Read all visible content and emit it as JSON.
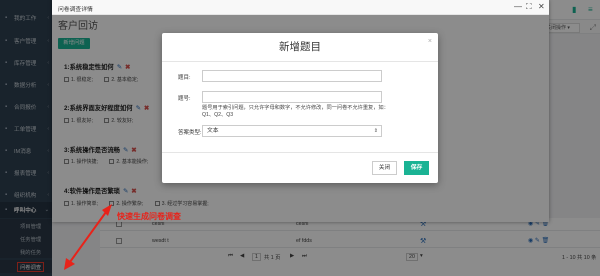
{
  "sidebar": {
    "items": [
      {
        "label": "我的工作",
        "icon": "briefcase-icon"
      },
      {
        "label": "客户管理",
        "icon": "user-icon"
      },
      {
        "label": "库存管理",
        "icon": "box-icon"
      },
      {
        "label": "数据分析",
        "icon": "chart-icon"
      },
      {
        "label": "合同报价",
        "icon": "file-icon"
      },
      {
        "label": "工单管理",
        "icon": "ticket-icon"
      },
      {
        "label": "IM消息",
        "icon": "chat-icon"
      },
      {
        "label": "报表管理",
        "icon": "report-icon"
      },
      {
        "label": "组织机构",
        "icon": "org-icon"
      },
      {
        "label": "呼叫中心",
        "icon": "phone-icon"
      }
    ],
    "subitems": [
      {
        "label": "项目管理"
      },
      {
        "label": "任务管理"
      },
      {
        "label": "我的任务"
      },
      {
        "label": "问卷调查"
      }
    ]
  },
  "background": {
    "close_ops_label": "关闭操作 ▾",
    "rows": [
      {
        "name": "ceshi",
        "desc": "ceshi"
      },
      {
        "name": "wesdt t",
        "desc": "ef fdds"
      }
    ],
    "pager": {
      "current_page": "1",
      "total_pages_text": "共 1 页",
      "page_size": "20",
      "range_text": "1 - 10 共 10 条"
    }
  },
  "survey": {
    "window_title": "问卷调查详情",
    "heading": "客户回访",
    "new_question_button": "新增问题",
    "questions": [
      {
        "title": "1:系统稳定性如何",
        "options": [
          "1. 很稳定;",
          "2. 基本稳定;"
        ]
      },
      {
        "title": "2:系统界面友好程度如何",
        "options": [
          "1. 很友好;",
          "2. 较友好;"
        ]
      },
      {
        "title": "3:系统操作是否流畅",
        "options": [
          "1. 操作快捷;",
          "2. 基本能操作;"
        ]
      },
      {
        "title": "4:软件操作是否繁琐",
        "options": [
          "1. 操作简单;",
          "2. 操作繁杂;",
          "3. 经过学习容易掌握;"
        ]
      }
    ]
  },
  "modal": {
    "title": "新增题目",
    "close_glyph": "×",
    "field_topic_label": "题目:",
    "field_code_label": "题号:",
    "help_text": "题号用于索引问题，只允许字母和数字，不允许修改，同一问卷不允许重复，如：Q1、Q2、Q3",
    "answer_type_label": "答案类型:",
    "answer_type_value": "文本",
    "close_button": "关闭",
    "save_button": "保存"
  },
  "annotation": {
    "text": "快速生成问卷调查",
    "color": "#e8231a"
  },
  "colors": {
    "sidebar_bg": "#2f4050",
    "accent_green": "#1ab394",
    "delete_red": "#d9534f",
    "link_blue": "#2a6ebb"
  }
}
